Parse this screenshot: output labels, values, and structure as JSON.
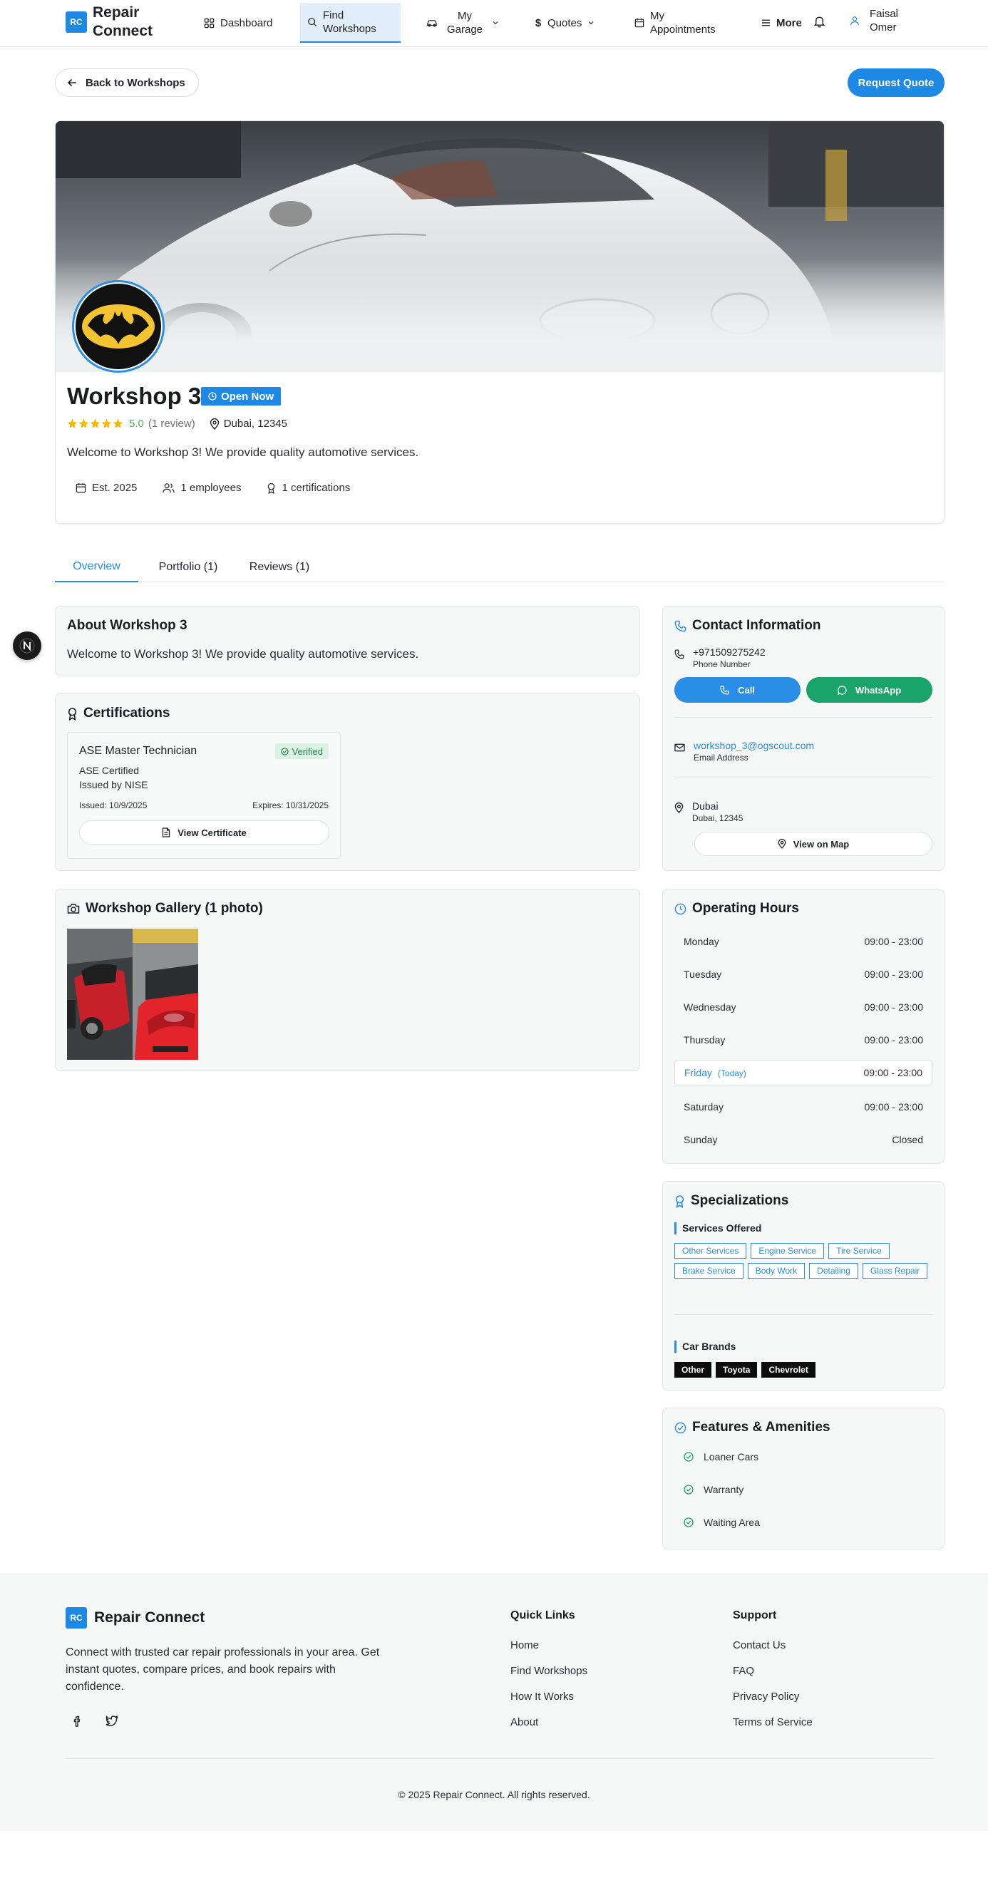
{
  "nav": {
    "logo": "RC",
    "brand": "Repair Connect",
    "items": [
      {
        "label": "Dashboard",
        "icon": "grid-icon"
      },
      {
        "label": "Find Workshops",
        "icon": "search-icon",
        "active": true
      },
      {
        "label": "My Garage",
        "icon": "car-icon"
      },
      {
        "label": "Quotes",
        "icon": "dollar-icon"
      },
      {
        "label": "My Appointments",
        "icon": "calendar-icon"
      },
      {
        "label": "More",
        "icon": "menu-icon"
      }
    ],
    "user": "Faisal Omer"
  },
  "actions": {
    "back": "Back to Workshops",
    "request_quote": "Request Quote"
  },
  "workshop": {
    "name": "Workshop 3",
    "status": "Open Now",
    "rating": "5.0",
    "rating_value": 5,
    "reviews": "(1 review)",
    "location": "Dubai, 12345",
    "description": "Welcome to Workshop 3! We provide quality automotive services.",
    "established": "Est. 2025",
    "employees": "1 employees",
    "certifications_count": "1 certifications"
  },
  "tabs": [
    "Overview",
    "Portfolio (1)",
    "Reviews (1)"
  ],
  "about": {
    "title": "About Workshop 3",
    "text": "Welcome to Workshop 3! We provide quality automotive services."
  },
  "certifications": {
    "title": "Certifications",
    "item": {
      "name": "ASE Master Technician",
      "badge": "Verified",
      "certified": "ASE Certified",
      "issuer": "Issued by NISE",
      "issued": "Issued: 10/9/2025",
      "expires": "Expires: 10/31/2025",
      "button": "View Certificate"
    }
  },
  "gallery": {
    "title": "Workshop Gallery (1 photo)"
  },
  "contact": {
    "title": "Contact Information",
    "phone": "+971509275242",
    "phone_label": "Phone Number",
    "call": "Call",
    "whatsapp": "WhatsApp",
    "email": "workshop_3@ogscout.com",
    "email_label": "Email Address",
    "city": "Dubai",
    "address": "Dubai, 12345",
    "map": "View on Map"
  },
  "hours": {
    "title": "Operating Hours",
    "today_tag": "(Today)",
    "days": [
      {
        "day": "Monday",
        "time": "09:00 - 23:00"
      },
      {
        "day": "Tuesday",
        "time": "09:00 - 23:00"
      },
      {
        "day": "Wednesday",
        "time": "09:00 - 23:00"
      },
      {
        "day": "Thursday",
        "time": "09:00 - 23:00"
      },
      {
        "day": "Friday",
        "time": "09:00 - 23:00",
        "today": true
      },
      {
        "day": "Saturday",
        "time": "09:00 - 23:00"
      },
      {
        "day": "Sunday",
        "time": "Closed"
      }
    ]
  },
  "specializations": {
    "title": "Specializations",
    "services_title": "Services Offered",
    "services": [
      "Other Services",
      "Engine Service",
      "Tire Service",
      "Brake Service",
      "Body Work",
      "Detailing",
      "Glass Repair"
    ],
    "brands_title": "Car Brands",
    "brands": [
      "Other",
      "Toyota",
      "Chevrolet"
    ]
  },
  "features": {
    "title": "Features & Amenities",
    "items": [
      "Loaner Cars",
      "Warranty",
      "Waiting Area"
    ]
  },
  "footer": {
    "logo": "RC",
    "brand": "Repair Connect",
    "description": "Connect with trusted car repair professionals in your area. Get instant quotes, compare prices, and book repairs with confidence.",
    "quick_links_title": "Quick Links",
    "quick_links": [
      "Home",
      "Find Workshops",
      "How It Works",
      "About"
    ],
    "support_title": "Support",
    "support_links": [
      "Contact Us",
      "FAQ",
      "Privacy Policy",
      "Terms of Service"
    ],
    "copyright": "© 2025 Repair Connect. All rights reserved."
  },
  "colors": {
    "primary": "#1e88e5",
    "success": "#1aa46a",
    "star": "#f5b800"
  }
}
